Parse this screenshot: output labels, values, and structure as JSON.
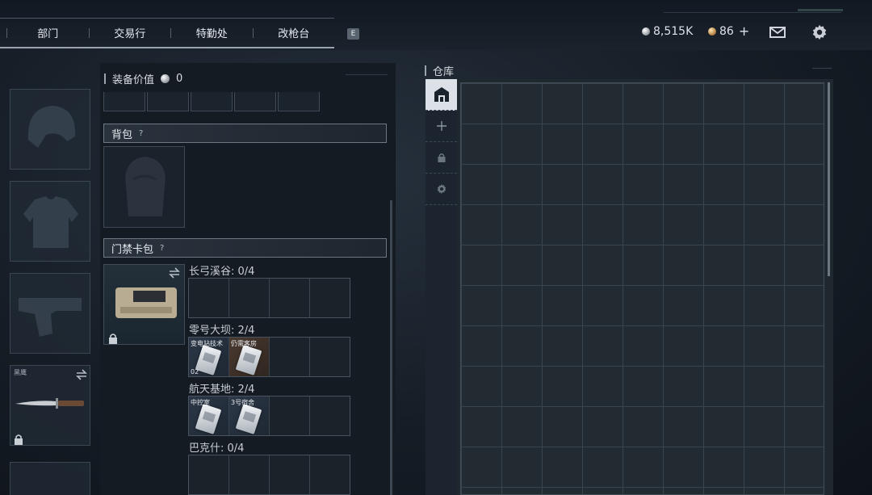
{
  "nav": {
    "tabs": [
      "部门",
      "交易行",
      "特勤处",
      "改枪台"
    ],
    "key_hint": "E"
  },
  "currency": {
    "silver": "8,515K",
    "bronze": "86",
    "plus": "+"
  },
  "icons": {
    "mail": "mail-icon",
    "settings": "gear-icon",
    "silver_coin": "silver-coin-icon",
    "bronze_coin": "bronze-coin-icon"
  },
  "left_slots": {
    "knife_label": "黑鹰"
  },
  "equipment": {
    "value_label": "装备价值",
    "value": "0"
  },
  "backpack": {
    "title": "背包",
    "help": "?"
  },
  "keycard_case": {
    "title": "门禁卡包",
    "help": "?",
    "maps": [
      {
        "label": "长弓溪谷: 0/4",
        "cards": []
      },
      {
        "label": "零号大坝: 2/4",
        "cards": [
          {
            "name": "变电站技术",
            "count": "02",
            "tone": "cool"
          },
          {
            "name": "仍需客房",
            "count": "",
            "tone": "warm"
          }
        ]
      },
      {
        "label": "航天基地: 2/4",
        "cards": [
          {
            "name": "中控室",
            "count": "",
            "tone": "cool"
          },
          {
            "name": "3号宿舍",
            "count": "",
            "tone": "cool"
          }
        ]
      },
      {
        "label": "巴克什: 0/4",
        "cards": []
      }
    ]
  },
  "warehouse": {
    "title": "仓库",
    "tabs": [
      "warehouse-home-icon",
      "plus-icon",
      "lock-icon",
      "gear-icon"
    ]
  },
  "colors": {
    "accent": "#dbe1e6",
    "background": "#161d26",
    "silver": "#b8bec4",
    "bronze": "#b07a3a"
  }
}
